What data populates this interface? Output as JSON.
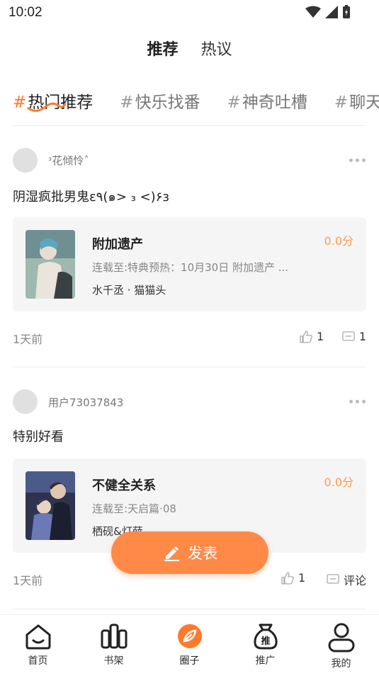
{
  "status_bar": {
    "time": "10:02"
  },
  "top_tabs": [
    {
      "label": "推荐",
      "active": true
    },
    {
      "label": "热议",
      "active": false
    }
  ],
  "topics": [
    {
      "hash": "#",
      "label": "热门推荐",
      "active": true
    },
    {
      "hash": "#",
      "label": "快乐找番",
      "active": false
    },
    {
      "hash": "#",
      "label": "神奇吐槽",
      "active": false
    },
    {
      "hash": "#",
      "label": "聊天",
      "active": false
    }
  ],
  "posts": [
    {
      "username": "ᵌ花倾怜ˆ",
      "text": "阴湿疯批男鬼ɛ٩(๑> ₃ <)۶з",
      "book": {
        "title": "附加遗产",
        "score": "0.0分",
        "chapter": "连载至:特典预热：10月30日 附加遗产 ...",
        "author": "水千丞 · 猫猫头"
      },
      "time_ago": "1天前",
      "likes": "1",
      "comments": "1"
    },
    {
      "username": "用户73037843",
      "text": "特别好看",
      "book": {
        "title": "不健全关系",
        "score": "0.0分",
        "chapter": "连载至:天启篇·08",
        "author": "栖砚&灯薛"
      },
      "time_ago": "1天前",
      "likes": "1",
      "comments": "评论"
    }
  ],
  "fab": {
    "label": "发表"
  },
  "bottom_nav": [
    {
      "label": "首页",
      "icon": "home-icon"
    },
    {
      "label": "书架",
      "icon": "bookshelf-icon"
    },
    {
      "label": "圈子",
      "icon": "circle-icon",
      "active": true
    },
    {
      "label": "推广",
      "icon": "promote-bag-icon",
      "badge": "推"
    },
    {
      "label": "我的",
      "icon": "profile-icon"
    }
  ],
  "colors": {
    "accent": "#ff7a2b",
    "card_bg": "#f5f5f5",
    "score": "#ff9a4a"
  }
}
